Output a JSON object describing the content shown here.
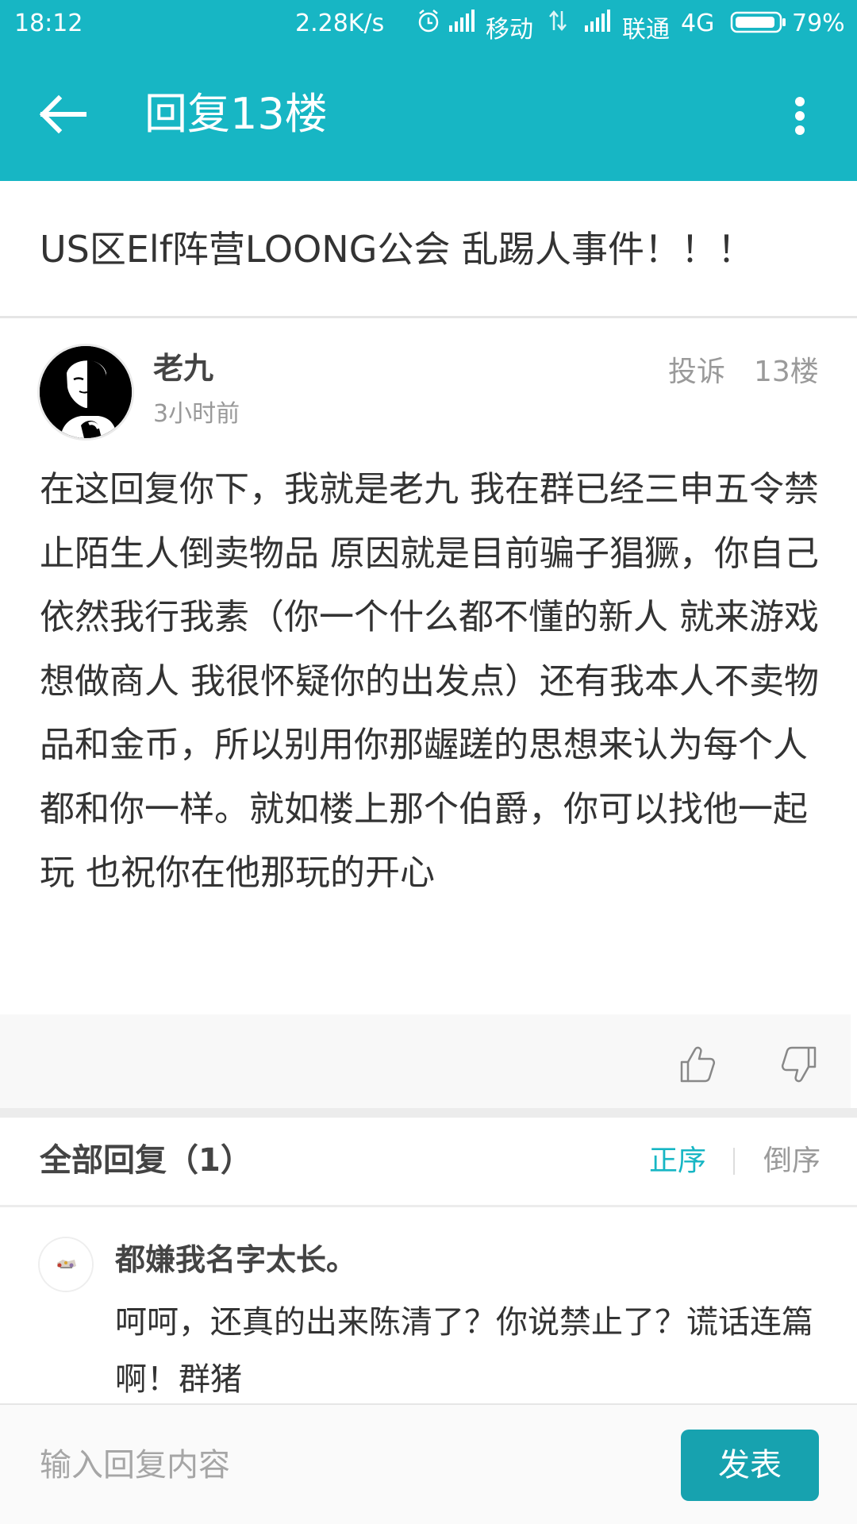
{
  "status_bar": {
    "time": "18:12",
    "net_speed": "2.28K/s",
    "carrier_1": "移动",
    "carrier_2": "联通",
    "network_type": "4G",
    "battery": "79%",
    "icons": [
      "alarm-icon",
      "signal-icon",
      "data-arrows-icon",
      "signal-icon",
      "battery-icon"
    ]
  },
  "app_bar": {
    "back_icon": "arrow-left-icon",
    "title": "回复13楼",
    "more_icon": "more-vertical-icon"
  },
  "thread": {
    "title": "US区Elf阵营LOONG公会 乱踢人事件！！！"
  },
  "post": {
    "author": "老九",
    "time": "3小时前",
    "report_label": "投诉",
    "floor_label": "13楼",
    "body": "在这回复你下，我就是老九 我在群已经三申五令禁止陌生人倒卖物品 原因就是目前骗子猖獗，你自己依然我行我素（你一个什么都不懂的新人 就来游戏想做商人 我很怀疑你的出发点）还有我本人不卖物品和金币，所以别用你那龌蹉的思想来认为每个人都和你一样。就如楼上那个伯爵，你可以找他一起玩 也祝你在他那玩的开心"
  },
  "reactions": {
    "like_icon": "thumbs-up-icon",
    "dislike_icon": "thumbs-down-icon"
  },
  "replies": {
    "heading": "全部回复（1）",
    "sort_asc": "正序",
    "sort_desc": "倒序",
    "items": [
      {
        "author": "都嫌我名字太长。",
        "body": "呵呵，还真的出来陈清了？你说禁止了？谎话连篇啊！群猪"
      }
    ]
  },
  "composer": {
    "placeholder": "输入回复内容",
    "submit_label": "发表"
  },
  "colors": {
    "accent": "#17B6C4",
    "button": "#17A2AF",
    "muted_text": "#9A9A9A"
  }
}
